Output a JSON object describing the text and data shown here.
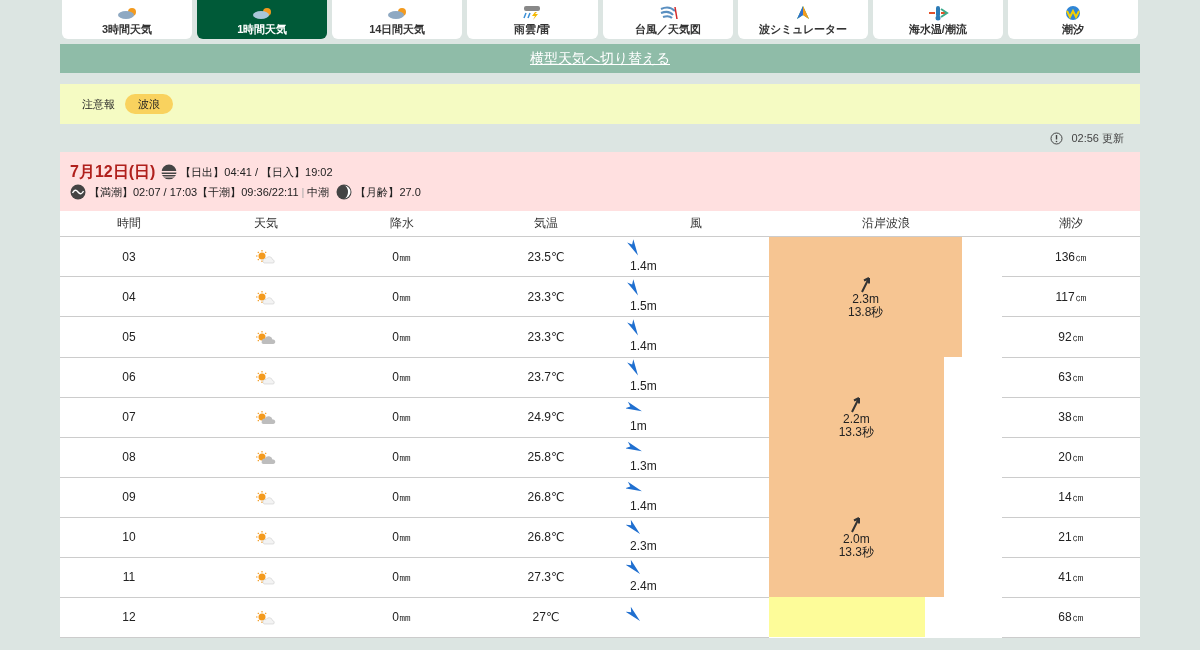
{
  "tabs": [
    {
      "label": "3時間天気",
      "selected": false
    },
    {
      "label": "1時間天気",
      "selected": true
    },
    {
      "label": "14日間天気",
      "selected": false
    },
    {
      "label": "雨雲/雷",
      "selected": false
    },
    {
      "label": "台風／天気図",
      "selected": false
    },
    {
      "label": "波シミュレーター",
      "selected": false
    },
    {
      "label": "海水温/潮流",
      "selected": false
    },
    {
      "label": "潮汐",
      "selected": false
    }
  ],
  "switch_link": "横型天気へ切り替える",
  "advisory": {
    "label": "注意報",
    "tags": [
      "波浪"
    ]
  },
  "updated": "02:56 更新",
  "day": {
    "date": "7月12日(日)",
    "sun": "【日出】04:41 / 【日入】19:02",
    "tide": "【満潮】02:07 / 17:03【干潮】09:36/22:11",
    "separator": "|",
    "tide_name": "中潮",
    "moon": "【月齢】27.0"
  },
  "columns": [
    "時間",
    "天気",
    "降水",
    "気温",
    "風",
    "沿岸波浪",
    "潮汐"
  ],
  "rows": [
    {
      "time": "03",
      "weather": {
        "kind": "sun_cloud"
      },
      "precip": "0㎜",
      "temp": "23.5℃",
      "wind": {
        "kind": "sse",
        "speed": "1.4m"
      },
      "tide": "136㎝",
      "wave": {
        "height": "2.3m",
        "period": "13.8秒",
        "level": 0.83,
        "color": "#f6c592"
      }
    },
    {
      "time": "04",
      "weather": {
        "kind": "sun_cloud"
      },
      "precip": "0㎜",
      "temp": "23.3℃",
      "wind": {
        "kind": "sse",
        "speed": "1.5m"
      },
      "tide": "117㎝"
    },
    {
      "time": "05",
      "weather": {
        "kind": "cloud_sun"
      },
      "precip": "0㎜",
      "temp": "23.3℃",
      "wind": {
        "kind": "sse",
        "speed": "1.4m"
      },
      "tide": "92㎝"
    },
    {
      "time": "06",
      "weather": {
        "kind": "sun_cloud"
      },
      "precip": "0㎜",
      "temp": "23.7℃",
      "wind": {
        "kind": "sse",
        "speed": "1.5m"
      },
      "tide": "63㎝",
      "wave": {
        "height": "2.2m",
        "period": "13.3秒",
        "level": 0.75,
        "color": "#f6c592"
      }
    },
    {
      "time": "07",
      "weather": {
        "kind": "cloud_sun"
      },
      "precip": "0㎜",
      "temp": "24.9℃",
      "wind": {
        "kind": "ese",
        "speed": "1m"
      },
      "tide": "38㎝"
    },
    {
      "time": "08",
      "weather": {
        "kind": "cloud_sun"
      },
      "precip": "0㎜",
      "temp": "25.8℃",
      "wind": {
        "kind": "ese",
        "speed": "1.3m"
      },
      "tide": "20㎝"
    },
    {
      "time": "09",
      "weather": {
        "kind": "sun_cloud"
      },
      "precip": "0㎜",
      "temp": "26.8℃",
      "wind": {
        "kind": "ese",
        "speed": "1.4m"
      },
      "tide": "14㎝",
      "wave": {
        "height": "2.0m",
        "period": "13.3秒",
        "level": 0.75,
        "color": "#f6c592"
      }
    },
    {
      "time": "10",
      "weather": {
        "kind": "sun_cloud"
      },
      "precip": "0㎜",
      "temp": "26.8℃",
      "wind": {
        "kind": "se",
        "speed": "2.3m"
      },
      "tide": "21㎝"
    },
    {
      "time": "11",
      "weather": {
        "kind": "sun_cloud"
      },
      "precip": "0㎜",
      "temp": "27.3℃",
      "wind": {
        "kind": "se",
        "speed": "2.4m"
      },
      "tide": "41㎝"
    },
    {
      "time": "12",
      "weather": {
        "kind": "sun_cloud"
      },
      "precip": "0㎜",
      "temp": "27℃",
      "wind": {
        "kind": "se"
      },
      "tide": "68㎝",
      "wave": {
        "level": 0.67,
        "color": "#fdfc99"
      }
    }
  ]
}
